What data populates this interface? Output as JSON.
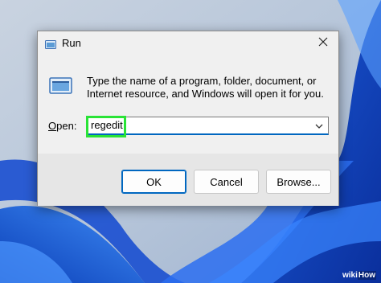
{
  "window": {
    "title": "Run",
    "icon": "run-icon",
    "close_icon": "close-icon"
  },
  "dialog": {
    "description_line1": "Type the name of a program, folder, document, or",
    "description_line2": "Internet resource, and Windows will open it for you.",
    "open_label_accel": "O",
    "open_label_rest": "pen:",
    "input_value": "regedit",
    "dropdown_icon": "chevron-down-icon"
  },
  "buttons": {
    "ok": "OK",
    "cancel": "Cancel",
    "browse": "Browse..."
  },
  "highlight_color": "#29e336",
  "accent_color": "#0067c0",
  "watermark": {
    "wiki": "wiki",
    "how": "How"
  }
}
